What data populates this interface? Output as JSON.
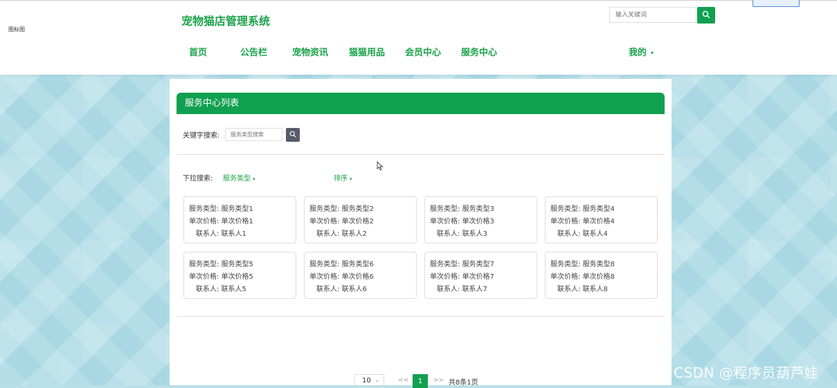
{
  "header": {
    "corner_text": "图标图",
    "site_title": "宠物猫店管理系统",
    "search": {
      "placeholder": "输入关键词"
    },
    "nav": [
      {
        "label": "首页"
      },
      {
        "label": "公告栏"
      },
      {
        "label": "宠物资讯"
      },
      {
        "label": "猫猫用品"
      },
      {
        "label": "会员中心"
      },
      {
        "label": "服务中心"
      }
    ],
    "user_menu": {
      "label": "我的",
      "caret": "▾"
    }
  },
  "panel": {
    "title": "服务中心列表",
    "keyword_label": "关键字搜索:",
    "keyword_placeholder": "服务类型搜索",
    "dropdown_label": "下拉搜索:",
    "filter_type": "服务类型",
    "sort": "排序",
    "caret": "▾",
    "card_labels": {
      "type": "服务类型:",
      "price": "单次价格:",
      "contact": "联系人:"
    },
    "cards": [
      {
        "type": "服务类型1",
        "price": "单次价格1",
        "contact": "联系人1"
      },
      {
        "type": "服务类型2",
        "price": "单次价格2",
        "contact": "联系人2"
      },
      {
        "type": "服务类型3",
        "price": "单次价格3",
        "contact": "联系人3"
      },
      {
        "type": "服务类型4",
        "price": "单次价格4",
        "contact": "联系人4"
      },
      {
        "type": "服务类型5",
        "price": "单次价格5",
        "contact": "联系人5"
      },
      {
        "type": "服务类型6",
        "price": "单次价格6",
        "contact": "联系人6"
      },
      {
        "type": "服务类型7",
        "price": "单次价格7",
        "contact": "联系人7"
      },
      {
        "type": "服务类型8",
        "price": "单次价格8",
        "contact": "联系人8"
      }
    ]
  },
  "pagination": {
    "page_size": "10",
    "prev": "<<",
    "current_page": "1",
    "next": ">>",
    "total": "共8条1页"
  },
  "watermark": "CSDN @程序员葫芦娃",
  "colors": {
    "accent": "#11a050",
    "text_green": "#1aa34a",
    "background": "#a9d8e4"
  }
}
